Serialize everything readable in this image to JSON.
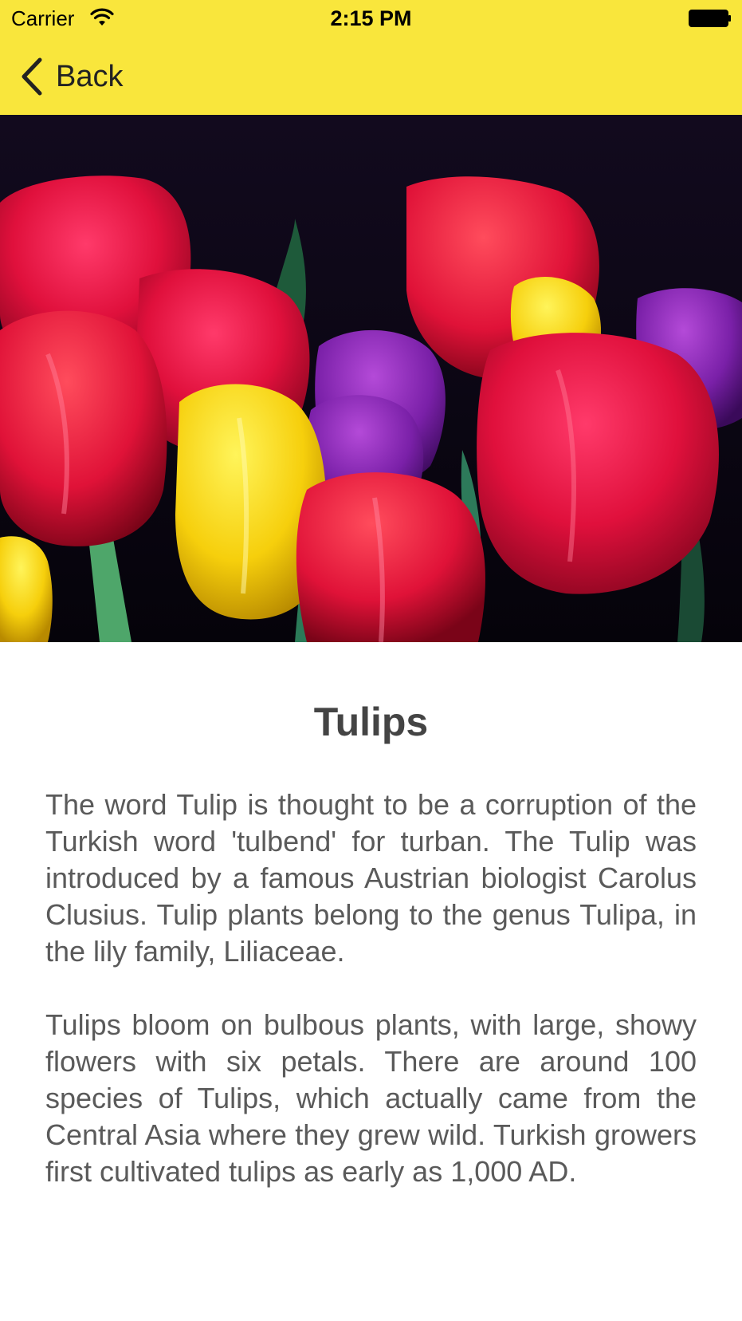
{
  "status_bar": {
    "carrier": "Carrier",
    "time": "2:15 PM"
  },
  "nav": {
    "back_label": "Back",
    "bar_color": "#f9e63c"
  },
  "hero_image": {
    "subject": "tulips"
  },
  "article": {
    "title": "Tulips",
    "paragraphs": [
      "The word Tulip is thought to be a corruption of the Turkish word 'tulbend' for turban. The Tulip was introduced by a famous Austrian biologist Carolus Clusius. Tulip plants belong to the genus Tulipa, in the lily family, Liliaceae.",
      "Tulips bloom on bulbous plants, with large, showy flowers with six petals. There are around 100 species of Tulips, which actually came from the Central Asia where they grew wild. Turkish growers first cultivated tulips as early as 1,000 AD."
    ]
  }
}
